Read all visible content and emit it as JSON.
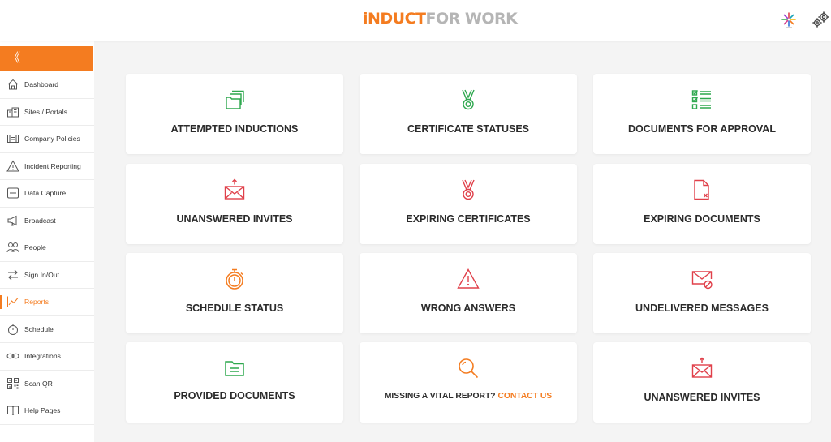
{
  "header": {
    "logo_part1": "iNDUCT",
    "logo_part2": "FOR WORK",
    "icons": [
      "company-logo-icon",
      "settings-gears-icon"
    ]
  },
  "sidebar": {
    "collapse_label": "《",
    "items": [
      {
        "label": "Dashboard",
        "icon": "home-icon"
      },
      {
        "label": "Sites / Portals",
        "icon": "buildings-icon"
      },
      {
        "label": "Company Policies",
        "icon": "policy-icon"
      },
      {
        "label": "Incident Reporting",
        "icon": "warning-icon"
      },
      {
        "label": "Data Capture",
        "icon": "data-capture-icon"
      },
      {
        "label": "Broadcast",
        "icon": "megaphone-icon"
      },
      {
        "label": "People",
        "icon": "people-icon"
      },
      {
        "label": "Sign In/Out",
        "icon": "sign-in-out-icon"
      },
      {
        "label": "Reports",
        "icon": "reports-icon",
        "active": true
      },
      {
        "label": "Schedule",
        "icon": "stopwatch-icon"
      },
      {
        "label": "Integrations",
        "icon": "link-icon"
      },
      {
        "label": "Scan QR",
        "icon": "qr-code-icon"
      },
      {
        "label": "Help Pages",
        "icon": "book-icon"
      }
    ]
  },
  "cards": [
    {
      "title": "ATTEMPTED INDUCTIONS",
      "icon": "folders-icon",
      "color": "#2fa84f"
    },
    {
      "title": "CERTIFICATE STATUSES",
      "icon": "medal-icon",
      "color": "#2fa84f"
    },
    {
      "title": "DOCUMENTS FOR APPROVAL",
      "icon": "checklist-icon",
      "color": "#2fa84f"
    },
    {
      "title": "UNANSWERED INVITES",
      "icon": "envelope-send-icon",
      "color": "#e0404a"
    },
    {
      "title": "EXPIRING CERTIFICATES",
      "icon": "medal-icon",
      "color": "#e0404a"
    },
    {
      "title": "EXPIRING DOCUMENTS",
      "icon": "document-x-icon",
      "color": "#e0404a"
    },
    {
      "title": "SCHEDULE STATUS",
      "icon": "stopwatch-icon",
      "color": "#f47c20"
    },
    {
      "title": "WRONG ANSWERS",
      "icon": "warning-triangle-icon",
      "color": "#e0404a"
    },
    {
      "title": "UNDELIVERED MESSAGES",
      "icon": "envelope-blocked-icon",
      "color": "#e0404a"
    },
    {
      "title": "PROVIDED DOCUMENTS",
      "icon": "folder-icon",
      "color": "#2fa84f"
    },
    {
      "title": "MISSING A VITAL REPORT?",
      "link": "CONTACT US",
      "icon": "magnifier-icon",
      "color": "#f47c20"
    },
    {
      "title": "UNANSWERED INVITES",
      "icon": "envelope-send-icon",
      "color": "#e0404a"
    }
  ]
}
